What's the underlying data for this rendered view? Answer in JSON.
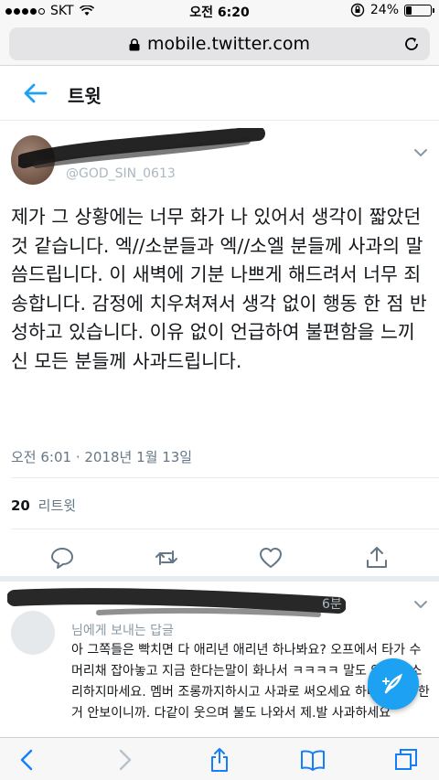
{
  "status_bar": {
    "carrier": "SKT",
    "time": "오전 6:20",
    "battery_percent": "24%",
    "battery_level": 0.24
  },
  "browser": {
    "url": "mobile.twitter.com"
  },
  "header": {
    "title": "트윗"
  },
  "tweet": {
    "handle": "@GOD_SIN_0613",
    "text": "제가 그 상황에는 너무 화가 나 있어서 생각이 짧았던 것 같습니다. 엑//소분들과 엑//소엘 분들께 사과의 말씀드립니다. 이 새벽에 기분 나쁘게 해드려서 너무 죄송합니다. 감정에 치우쳐져서 생각 없이 행동 한 점 반성하고 있습니다. 이유 없이 언급하여 불편함을 느끼신 모든 분들께 사과드립니다.",
    "timestamp": "오전 6:01 · 2018년 1월 13일",
    "retweet_count": "20",
    "retweet_label": "리트윗"
  },
  "reply": {
    "time_suffix": "6분",
    "subtitle": "님에게 보내는 답글",
    "text": "아 그쪽들은 빡치면 다 애리년 애리년 하나봐요? 오프에서 타가 수 머리채 잡아놓고 지금 한다는말이 화나서 ㅋㅋㅋㅋ 말도 안되는 소리하지마세요. 멤버 조롱까지하시고 사과로 써오세요 하나도 죄송한거 안보이니까. 다같이 웃으며 불도 나와서 제.발 사과하세요"
  },
  "icons": {
    "accent": "#1da1f2",
    "muted": "#657786",
    "toolbar_blue": "#157efb"
  }
}
